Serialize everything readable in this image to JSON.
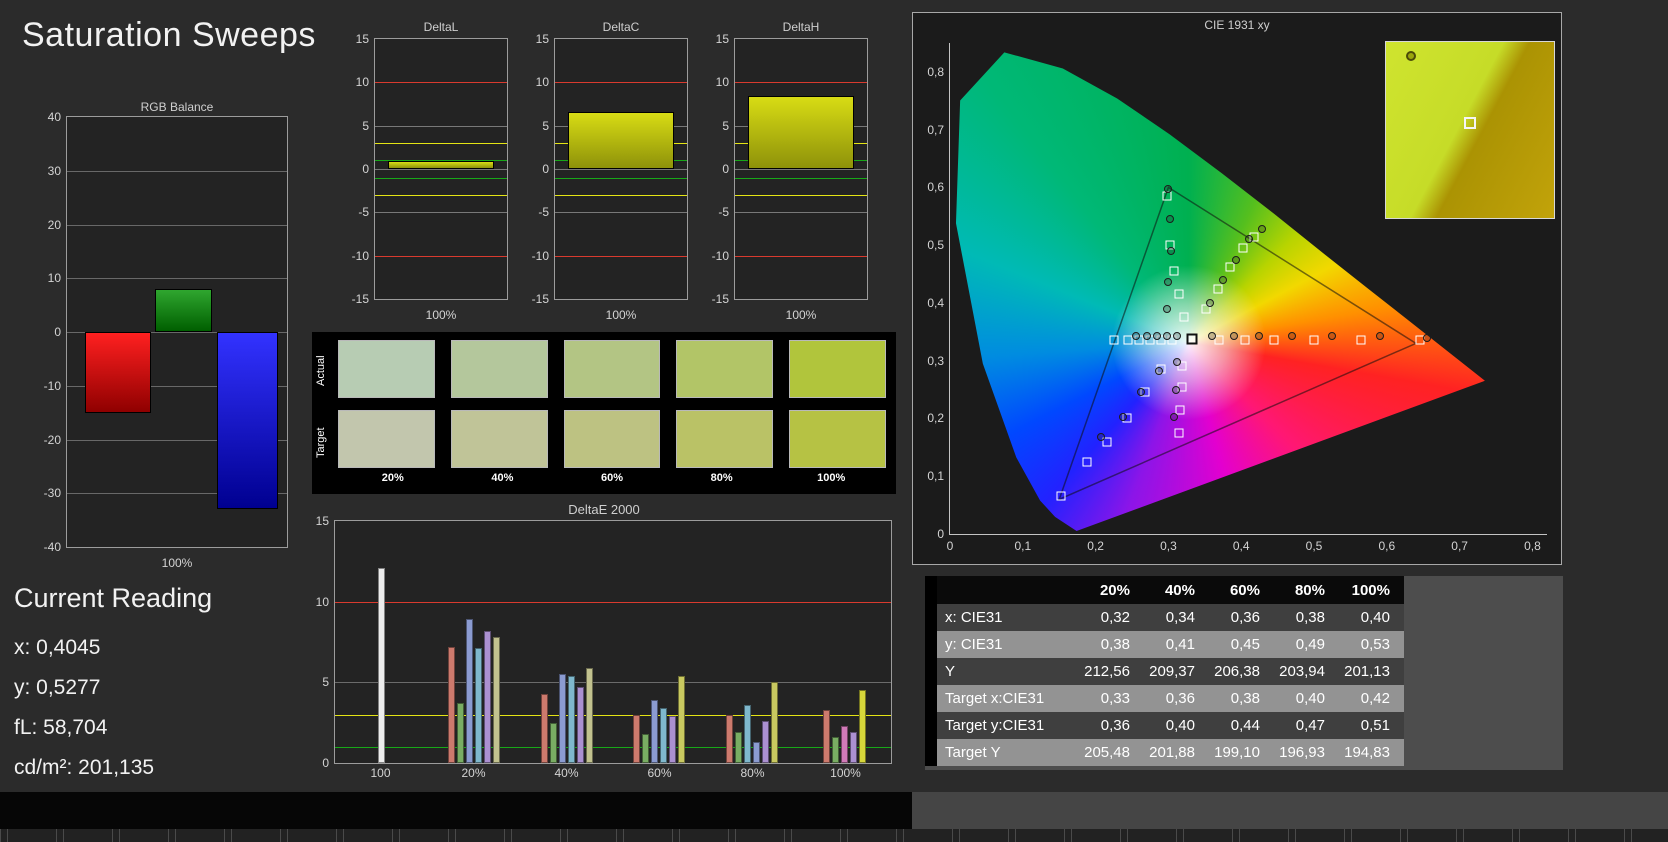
{
  "page": {
    "title": "Saturation Sweeps"
  },
  "rgb_balance": {
    "title": "RGB Balance",
    "xlabel": "100%",
    "ylim": [
      -40,
      40
    ],
    "yticks": [
      40,
      30,
      20,
      10,
      0,
      -10,
      -20,
      -30,
      -40
    ],
    "bars": [
      {
        "name": "red",
        "value": -15,
        "color_top": "#ff2020",
        "color_bottom": "#8f0000"
      },
      {
        "name": "green",
        "value": 8,
        "color_top": "#2fa62f",
        "color_bottom": "#005f00"
      },
      {
        "name": "blue",
        "value": -33,
        "color_top": "#3232ff",
        "color_bottom": "#000090"
      }
    ]
  },
  "current_reading": {
    "heading": "Current Reading",
    "lines": [
      "x: 0,4045",
      "y: 0,5277",
      "fL: 58,704",
      "cd/m²: 201,135"
    ]
  },
  "delta_charts": {
    "ylim": [
      -15,
      15
    ],
    "yticks": [
      15,
      10,
      5,
      0,
      -5,
      -10,
      -15
    ],
    "ref_lines": [
      {
        "value": 10,
        "color": "#d93a2e"
      },
      {
        "value": 5,
        "color": "#787878"
      },
      {
        "value": 3,
        "color": "#e4e414"
      },
      {
        "value": 1,
        "color": "#18a818"
      },
      {
        "value": 0,
        "color": "#787878"
      },
      {
        "value": -1,
        "color": "#18a818"
      },
      {
        "value": -3,
        "color": "#e4e414"
      },
      {
        "value": -5,
        "color": "#787878"
      },
      {
        "value": -10,
        "color": "#d93a2e"
      }
    ],
    "bar_top": "#d8dc14",
    "bar_bottom": "#8e920a",
    "charts": [
      {
        "title": "DeltaL",
        "xlabel": "100%",
        "value": 0.9
      },
      {
        "title": "DeltaC",
        "xlabel": "100%",
        "value": 6.6
      },
      {
        "title": "DeltaH",
        "xlabel": "100%",
        "value": 8.4
      }
    ]
  },
  "swatches": {
    "row_labels": [
      "Actual",
      "Target"
    ],
    "col_labels": [
      "20%",
      "40%",
      "60%",
      "80%",
      "100%"
    ],
    "actual_colors": [
      "#b7ccb3",
      "#b4c79c",
      "#b3c584",
      "#b2c567",
      "#b1c53c"
    ],
    "target_colors": [
      "#c2c6ad",
      "#c0c498",
      "#bdc282",
      "#bac266",
      "#b6c244"
    ]
  },
  "deltae2000": {
    "title": "DeltaE 2000",
    "ylim": [
      0,
      15
    ],
    "yticks": [
      15,
      10,
      5,
      0
    ],
    "ref_lines": [
      {
        "value": 10,
        "color": "#d93a2e"
      },
      {
        "value": 5,
        "color": "#6b6b6b"
      },
      {
        "value": 3,
        "color": "#e4e414"
      },
      {
        "value": 1,
        "color": "#18a818"
      }
    ],
    "groups": [
      {
        "label": "100",
        "bars": [
          {
            "value": 12.1,
            "color": "#ededed"
          }
        ]
      },
      {
        "label": "20%",
        "bars": [
          {
            "value": 7.2,
            "color": "#cd7a6d"
          },
          {
            "value": 3.7,
            "color": "#79ad63"
          },
          {
            "value": 8.9,
            "color": "#8b9bd1"
          },
          {
            "value": 7.1,
            "color": "#7fb8cd"
          },
          {
            "value": 8.2,
            "color": "#ab90d1"
          },
          {
            "value": 7.8,
            "color": "#c2c28f"
          }
        ]
      },
      {
        "label": "40%",
        "bars": [
          {
            "value": 4.3,
            "color": "#cd7a6d"
          },
          {
            "value": 2.5,
            "color": "#79ad63"
          },
          {
            "value": 5.5,
            "color": "#8b9bd1"
          },
          {
            "value": 5.4,
            "color": "#7fb8cd"
          },
          {
            "value": 4.7,
            "color": "#ab90d1"
          },
          {
            "value": 5.9,
            "color": "#c2c28f"
          }
        ]
      },
      {
        "label": "60%",
        "bars": [
          {
            "value": 3.0,
            "color": "#cd7a6d"
          },
          {
            "value": 1.8,
            "color": "#79ad63"
          },
          {
            "value": 3.9,
            "color": "#8b9bd1"
          },
          {
            "value": 3.4,
            "color": "#7fb8cd"
          },
          {
            "value": 2.9,
            "color": "#ab90d1"
          },
          {
            "value": 5.4,
            "color": "#c9c960"
          }
        ]
      },
      {
        "label": "80%",
        "bars": [
          {
            "value": 3.0,
            "color": "#cd7a6d"
          },
          {
            "value": 1.9,
            "color": "#79ad63"
          },
          {
            "value": 3.6,
            "color": "#7fb8cd"
          },
          {
            "value": 1.3,
            "color": "#8b9bd1"
          },
          {
            "value": 2.6,
            "color": "#ab90d1"
          },
          {
            "value": 5.0,
            "color": "#c9c960"
          }
        ]
      },
      {
        "label": "100%",
        "bars": [
          {
            "value": 3.3,
            "color": "#cd7a6d"
          },
          {
            "value": 1.6,
            "color": "#79ad63"
          },
          {
            "value": 2.3,
            "color": "#d17ab8"
          },
          {
            "value": 1.9,
            "color": "#ab90d1"
          },
          {
            "value": 4.5,
            "color": "#d6d63a"
          }
        ]
      }
    ]
  },
  "cie": {
    "title": "CIE 1931 xy",
    "xlim": [
      0,
      0.82
    ],
    "ylim": [
      0,
      0.85
    ],
    "xtick_labels": [
      "0",
      "0,1",
      "0,2",
      "0,3",
      "0,4",
      "0,5",
      "0,6",
      "0,7",
      "0,8"
    ],
    "ytick_labels": [
      "0",
      "0,1",
      "0,2",
      "0,3",
      "0,4",
      "0,5",
      "0,6",
      "0,7",
      "0,8"
    ],
    "triangle": [
      [
        0.64,
        0.33
      ],
      [
        0.3,
        0.6
      ],
      [
        0.15,
        0.06
      ]
    ],
    "current_point": [
      0.332,
      0.337
    ],
    "target_points": [
      [
        0.645,
        0.335
      ],
      [
        0.565,
        0.335
      ],
      [
        0.5,
        0.335
      ],
      [
        0.445,
        0.335
      ],
      [
        0.405,
        0.335
      ],
      [
        0.37,
        0.335
      ],
      [
        0.305,
        0.335
      ],
      [
        0.29,
        0.335
      ],
      [
        0.275,
        0.335
      ],
      [
        0.26,
        0.335
      ],
      [
        0.245,
        0.335
      ],
      [
        0.225,
        0.335
      ],
      [
        0.322,
        0.375
      ],
      [
        0.315,
        0.415
      ],
      [
        0.308,
        0.455
      ],
      [
        0.302,
        0.5
      ],
      [
        0.298,
        0.585
      ],
      [
        0.352,
        0.39
      ],
      [
        0.368,
        0.425
      ],
      [
        0.385,
        0.462
      ],
      [
        0.402,
        0.495
      ],
      [
        0.418,
        0.515
      ],
      [
        0.318,
        0.29
      ],
      [
        0.318,
        0.255
      ],
      [
        0.316,
        0.215
      ],
      [
        0.315,
        0.175
      ],
      [
        0.29,
        0.285
      ],
      [
        0.268,
        0.245
      ],
      [
        0.243,
        0.2
      ],
      [
        0.215,
        0.16
      ],
      [
        0.188,
        0.125
      ],
      [
        0.153,
        0.065
      ]
    ],
    "measured_points": [
      [
        0.3,
        0.597
      ],
      [
        0.302,
        0.545
      ],
      [
        0.303,
        0.49
      ],
      [
        0.3,
        0.437
      ],
      [
        0.298,
        0.39
      ],
      [
        0.357,
        0.4
      ],
      [
        0.375,
        0.44
      ],
      [
        0.393,
        0.475
      ],
      [
        0.41,
        0.51
      ],
      [
        0.428,
        0.528
      ],
      [
        0.36,
        0.342
      ],
      [
        0.39,
        0.342
      ],
      [
        0.425,
        0.342
      ],
      [
        0.47,
        0.342
      ],
      [
        0.525,
        0.342
      ],
      [
        0.59,
        0.342
      ],
      [
        0.655,
        0.34
      ],
      [
        0.312,
        0.342
      ],
      [
        0.298,
        0.342
      ],
      [
        0.284,
        0.342
      ],
      [
        0.27,
        0.342
      ],
      [
        0.256,
        0.342
      ],
      [
        0.287,
        0.283
      ],
      [
        0.263,
        0.245
      ],
      [
        0.237,
        0.203
      ],
      [
        0.208,
        0.168
      ],
      [
        0.312,
        0.298
      ],
      [
        0.31,
        0.25
      ],
      [
        0.307,
        0.203
      ]
    ],
    "inset": {
      "circle": [
        0.15,
        0.08
      ],
      "square": [
        0.5,
        0.46
      ]
    }
  },
  "table": {
    "columns": [
      "20%",
      "40%",
      "60%",
      "80%",
      "100%"
    ],
    "rows": [
      {
        "label": "x: CIE31",
        "values": [
          "0,32",
          "0,34",
          "0,36",
          "0,38",
          "0,40"
        ]
      },
      {
        "label": "y: CIE31",
        "values": [
          "0,38",
          "0,41",
          "0,45",
          "0,49",
          "0,53"
        ]
      },
      {
        "label": "Y",
        "values": [
          "212,56",
          "209,37",
          "206,38",
          "203,94",
          "201,13"
        ]
      },
      {
        "label": "Target x:CIE31",
        "values": [
          "0,33",
          "0,36",
          "0,38",
          "0,40",
          "0,42"
        ]
      },
      {
        "label": "Target y:CIE31",
        "values": [
          "0,36",
          "0,40",
          "0,44",
          "0,47",
          "0,51"
        ]
      },
      {
        "label": "Target Y",
        "values": [
          "205,48",
          "201,88",
          "199,10",
          "196,93",
          "194,83"
        ]
      }
    ]
  }
}
